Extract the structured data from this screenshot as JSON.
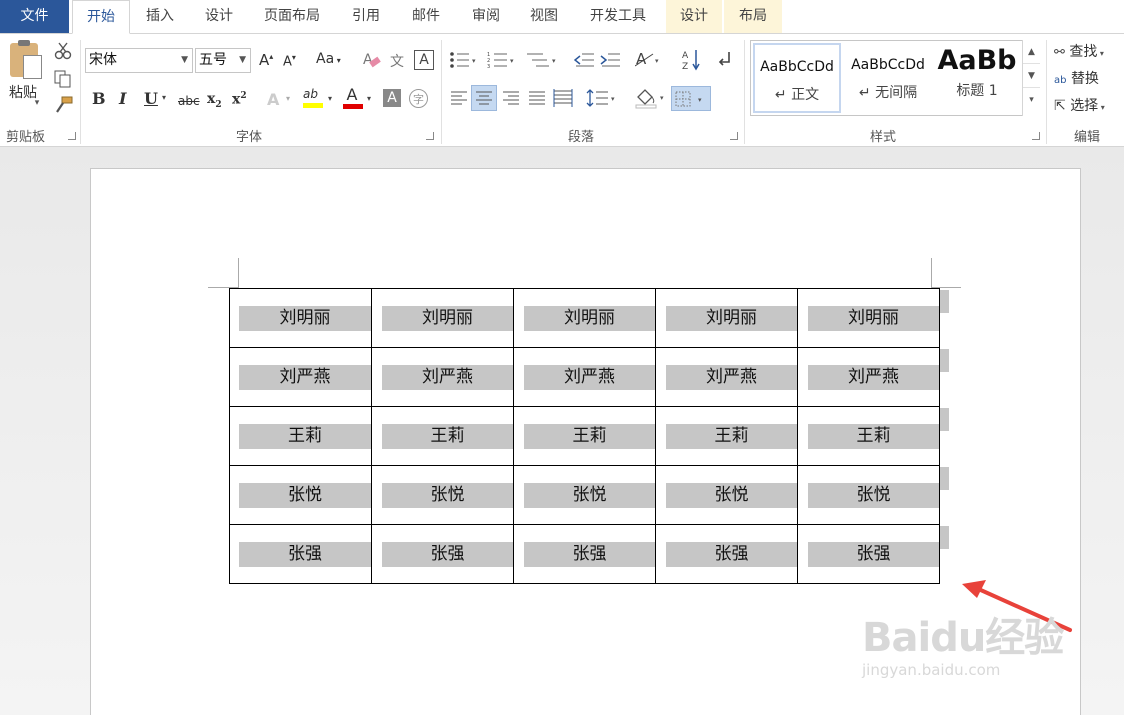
{
  "tabs": [
    {
      "label": "文件"
    },
    {
      "label": "开始"
    },
    {
      "label": "插入"
    },
    {
      "label": "设计"
    },
    {
      "label": "页面布局"
    },
    {
      "label": "引用"
    },
    {
      "label": "邮件"
    },
    {
      "label": "审阅"
    },
    {
      "label": "视图"
    },
    {
      "label": "开发工具"
    },
    {
      "label": "设计"
    },
    {
      "label": "布局"
    }
  ],
  "active_tab": "开始",
  "ribbon": {
    "clipboard": {
      "paste_label": "粘贴",
      "group_label": "剪贴板"
    },
    "font": {
      "font_name": "宋体",
      "font_size": "五号",
      "group_label": "字体",
      "grow_label": "A",
      "shrink_label": "A",
      "case_label": "Aa",
      "phonetic_label": "文",
      "border_label": "A",
      "bold_label": "B",
      "italic_label": "I",
      "underline_label": "U",
      "strike_label": "abc",
      "sub_label": "x",
      "sub_sub": "2",
      "sup_label": "x",
      "sup_sup": "2",
      "effects_label": "A",
      "highlight_label": "ab",
      "font_color_label": "A",
      "shading_label": "A",
      "enclose_label": "字"
    },
    "paragraph": {
      "group_label": "段落"
    },
    "styles": {
      "group_label": "样式",
      "items": [
        {
          "sample": "AaBbCcDd",
          "name": "↵ 正文"
        },
        {
          "sample": "AaBbCcDd",
          "name": "↵ 无间隔"
        },
        {
          "sample": "AaBb",
          "name": "标题 1"
        }
      ]
    },
    "editing": {
      "group_label": "编辑",
      "find_label": "查找",
      "replace_label": "替换",
      "select_label": "选择"
    }
  },
  "colors": {
    "file_tab": "#2b579a",
    "highlight_yellow": "#ffff00",
    "font_red": "#e00000",
    "cell_shading": "#c6c6c6",
    "arrow": "#e8423a"
  },
  "document": {
    "table_rows": [
      [
        "刘明丽",
        "刘明丽",
        "刘明丽",
        "刘明丽",
        "刘明丽"
      ],
      [
        "刘严燕",
        "刘严燕",
        "刘严燕",
        "刘严燕",
        "刘严燕"
      ],
      [
        "王莉",
        "王莉",
        "王莉",
        "王莉",
        "王莉"
      ],
      [
        "张悦",
        "张悦",
        "张悦",
        "张悦",
        "张悦"
      ],
      [
        "张强",
        "张强",
        "张强",
        "张强",
        "张强"
      ]
    ]
  },
  "watermark": {
    "brand": "Baidu经验",
    "url": "jingyan.baidu.com"
  }
}
